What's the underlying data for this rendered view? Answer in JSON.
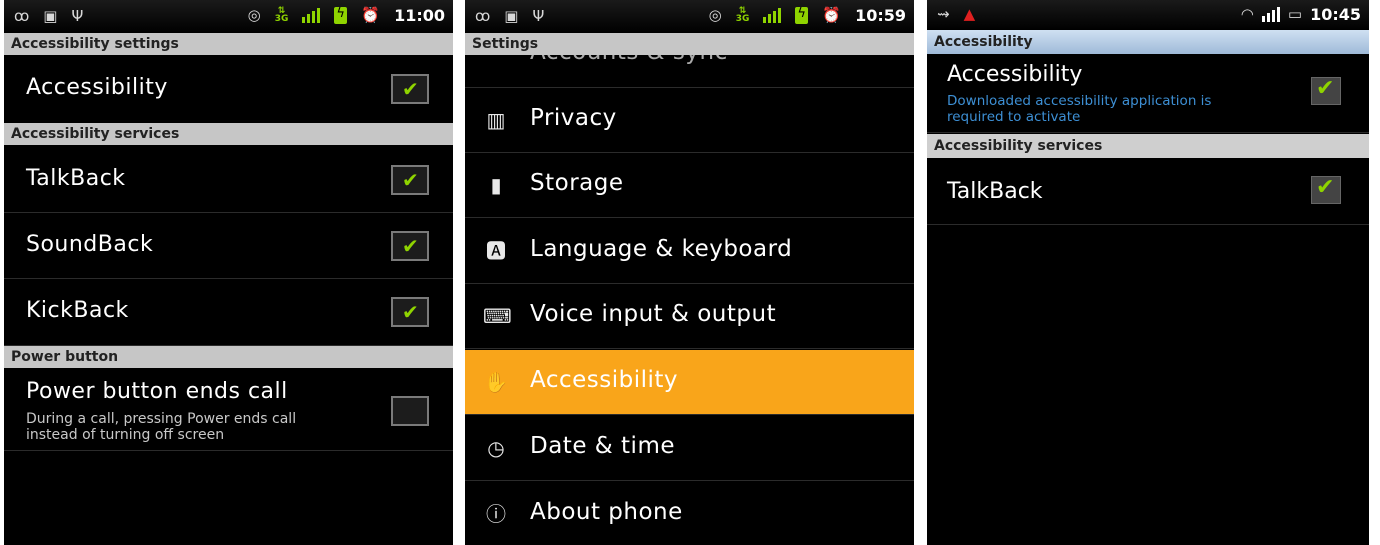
{
  "panel1": {
    "status_time": "11:00",
    "header_title": "Accessibility settings",
    "main_item": {
      "label": "Accessibility",
      "checked": true
    },
    "services_header": "Accessibility services",
    "services": [
      {
        "label": "TalkBack",
        "checked": true
      },
      {
        "label": "SoundBack",
        "checked": true
      },
      {
        "label": "KickBack",
        "checked": true
      }
    ],
    "power_header": "Power button",
    "power_item": {
      "label": "Power button ends call",
      "summary_line1": "During a call, pressing Power ends call",
      "summary_line2": "instead of turning off screen",
      "checked": false
    }
  },
  "panel2": {
    "status_time": "10:59",
    "header_title": "Settings",
    "partial_item": "Accounts & sync",
    "items": [
      {
        "label": "Privacy",
        "icon": "privacy-icon"
      },
      {
        "label": "Storage",
        "icon": "storage-icon"
      },
      {
        "label": "Language & keyboard",
        "icon": "language-icon"
      },
      {
        "label": "Voice input & output",
        "icon": "voice-icon"
      },
      {
        "label": "Accessibility",
        "icon": "hand-icon",
        "selected": true
      },
      {
        "label": "Date & time",
        "icon": "clock-icon"
      },
      {
        "label": "About phone",
        "icon": "info-icon"
      }
    ]
  },
  "panel3": {
    "status_time": "10:45",
    "header_title": "Accessibility",
    "main_item": {
      "label": "Accessibility",
      "summary_line1": "Downloaded accessibility application is",
      "summary_line2": "required to activate",
      "checked": true
    },
    "services_header": "Accessibility services",
    "services": [
      {
        "label": "TalkBack",
        "checked": true
      }
    ]
  },
  "colors": {
    "accent_green": "#8fd400",
    "selection_orange": "#f9a51a",
    "summary_blue": "#3d8fd4",
    "header_gray": "#c6c6c6"
  }
}
